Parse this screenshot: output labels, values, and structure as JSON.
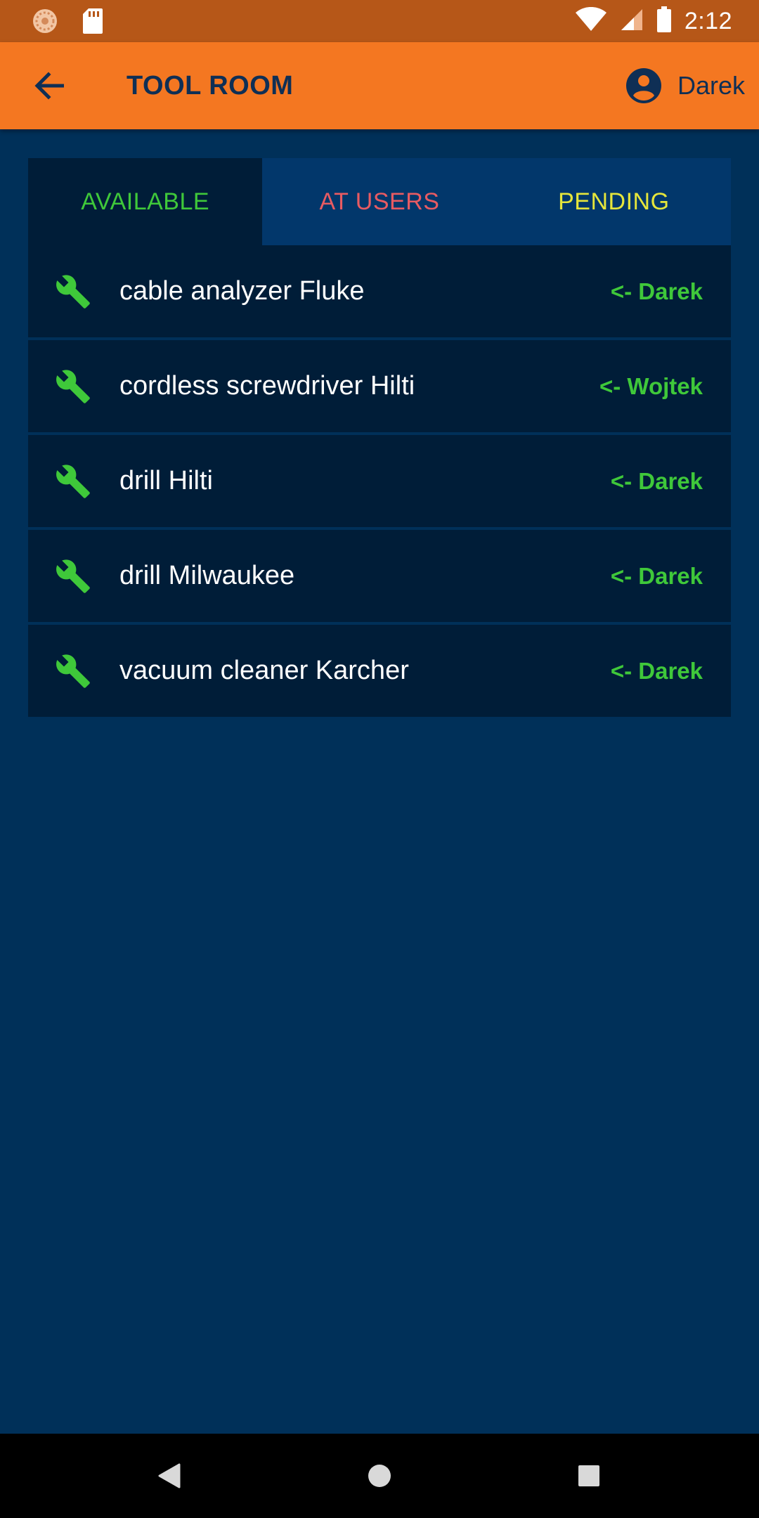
{
  "status_bar": {
    "time": "2:12",
    "left_icons": [
      "spinner-icon",
      "sd-card-icon"
    ],
    "right_icons": [
      "wifi-icon",
      "signal-icon",
      "battery-icon"
    ]
  },
  "app_bar": {
    "back_icon": "arrow-back-icon",
    "title": "TOOL ROOM",
    "user_icon": "account-circle-icon",
    "user_name": "Darek"
  },
  "tabs": [
    {
      "label": "AVAILABLE",
      "active": true,
      "color": "#3fc83a"
    },
    {
      "label": "AT USERS",
      "active": false,
      "color": "#e85b62"
    },
    {
      "label": "PENDING",
      "active": false,
      "color": "#e5e53b"
    }
  ],
  "tools": [
    {
      "name": "cable analyzer Fluke",
      "user": "<- Darek",
      "icon": "wrench-icon"
    },
    {
      "name": "cordless screwdriver Hilti",
      "user": "<- Wojtek",
      "icon": "wrench-icon"
    },
    {
      "name": "drill Hilti",
      "user": "<- Darek",
      "icon": "wrench-icon"
    },
    {
      "name": "drill Milwaukee",
      "user": "<- Darek",
      "icon": "wrench-icon"
    },
    {
      "name": "vacuum cleaner Karcher",
      "user": "<- Darek",
      "icon": "wrench-icon"
    }
  ],
  "nav_bar": {
    "icons": [
      "back-triangle-icon",
      "home-circle-icon",
      "recents-square-icon"
    ]
  },
  "colors": {
    "status_bar": "#b65718",
    "app_bar": "#f47721",
    "background": "#003059",
    "row": "#001d38",
    "accent_green": "#3fc83a"
  }
}
